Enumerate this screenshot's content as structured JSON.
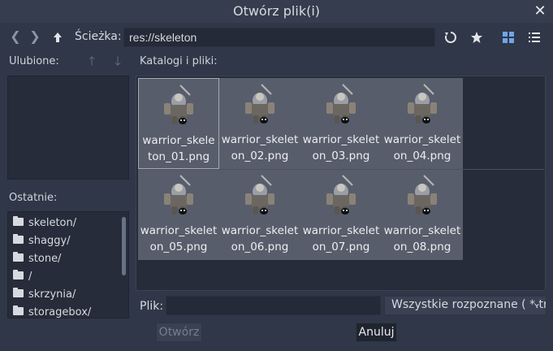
{
  "window": {
    "title": "Otwórz plik(i)"
  },
  "nav": {
    "back": "❮",
    "forward": "❯",
    "up": "🡑",
    "path_label": "Ścieżka:",
    "path_value": "res://skeleton"
  },
  "favorites": {
    "label": "Ulubione:"
  },
  "recent": {
    "label": "Ostatnie:",
    "items": [
      "skeleton/",
      "shaggy/",
      "stone/",
      "/",
      "skrzynia/",
      "storagebox/"
    ]
  },
  "files": {
    "label": "Katalogi i pliki:",
    "items": [
      "warrior_skeleton_01.png",
      "warrior_skeleton_02.png",
      "warrior_skeleton_03.png",
      "warrior_skeleton_04.png",
      "warrior_skeleton_05.png",
      "warrior_skeleton_06.png",
      "warrior_skeleton_07.png",
      "warrior_skeleton_08.png"
    ]
  },
  "footer": {
    "file_label": "Plik:",
    "file_value": "",
    "filter": "Wszystkie rozpoznane ( *.tres",
    "open": "Otwórz",
    "cancel": "Anuluj"
  },
  "colors": {
    "accent": "#6ea6e8",
    "thumb_bg": "#585d6b"
  }
}
